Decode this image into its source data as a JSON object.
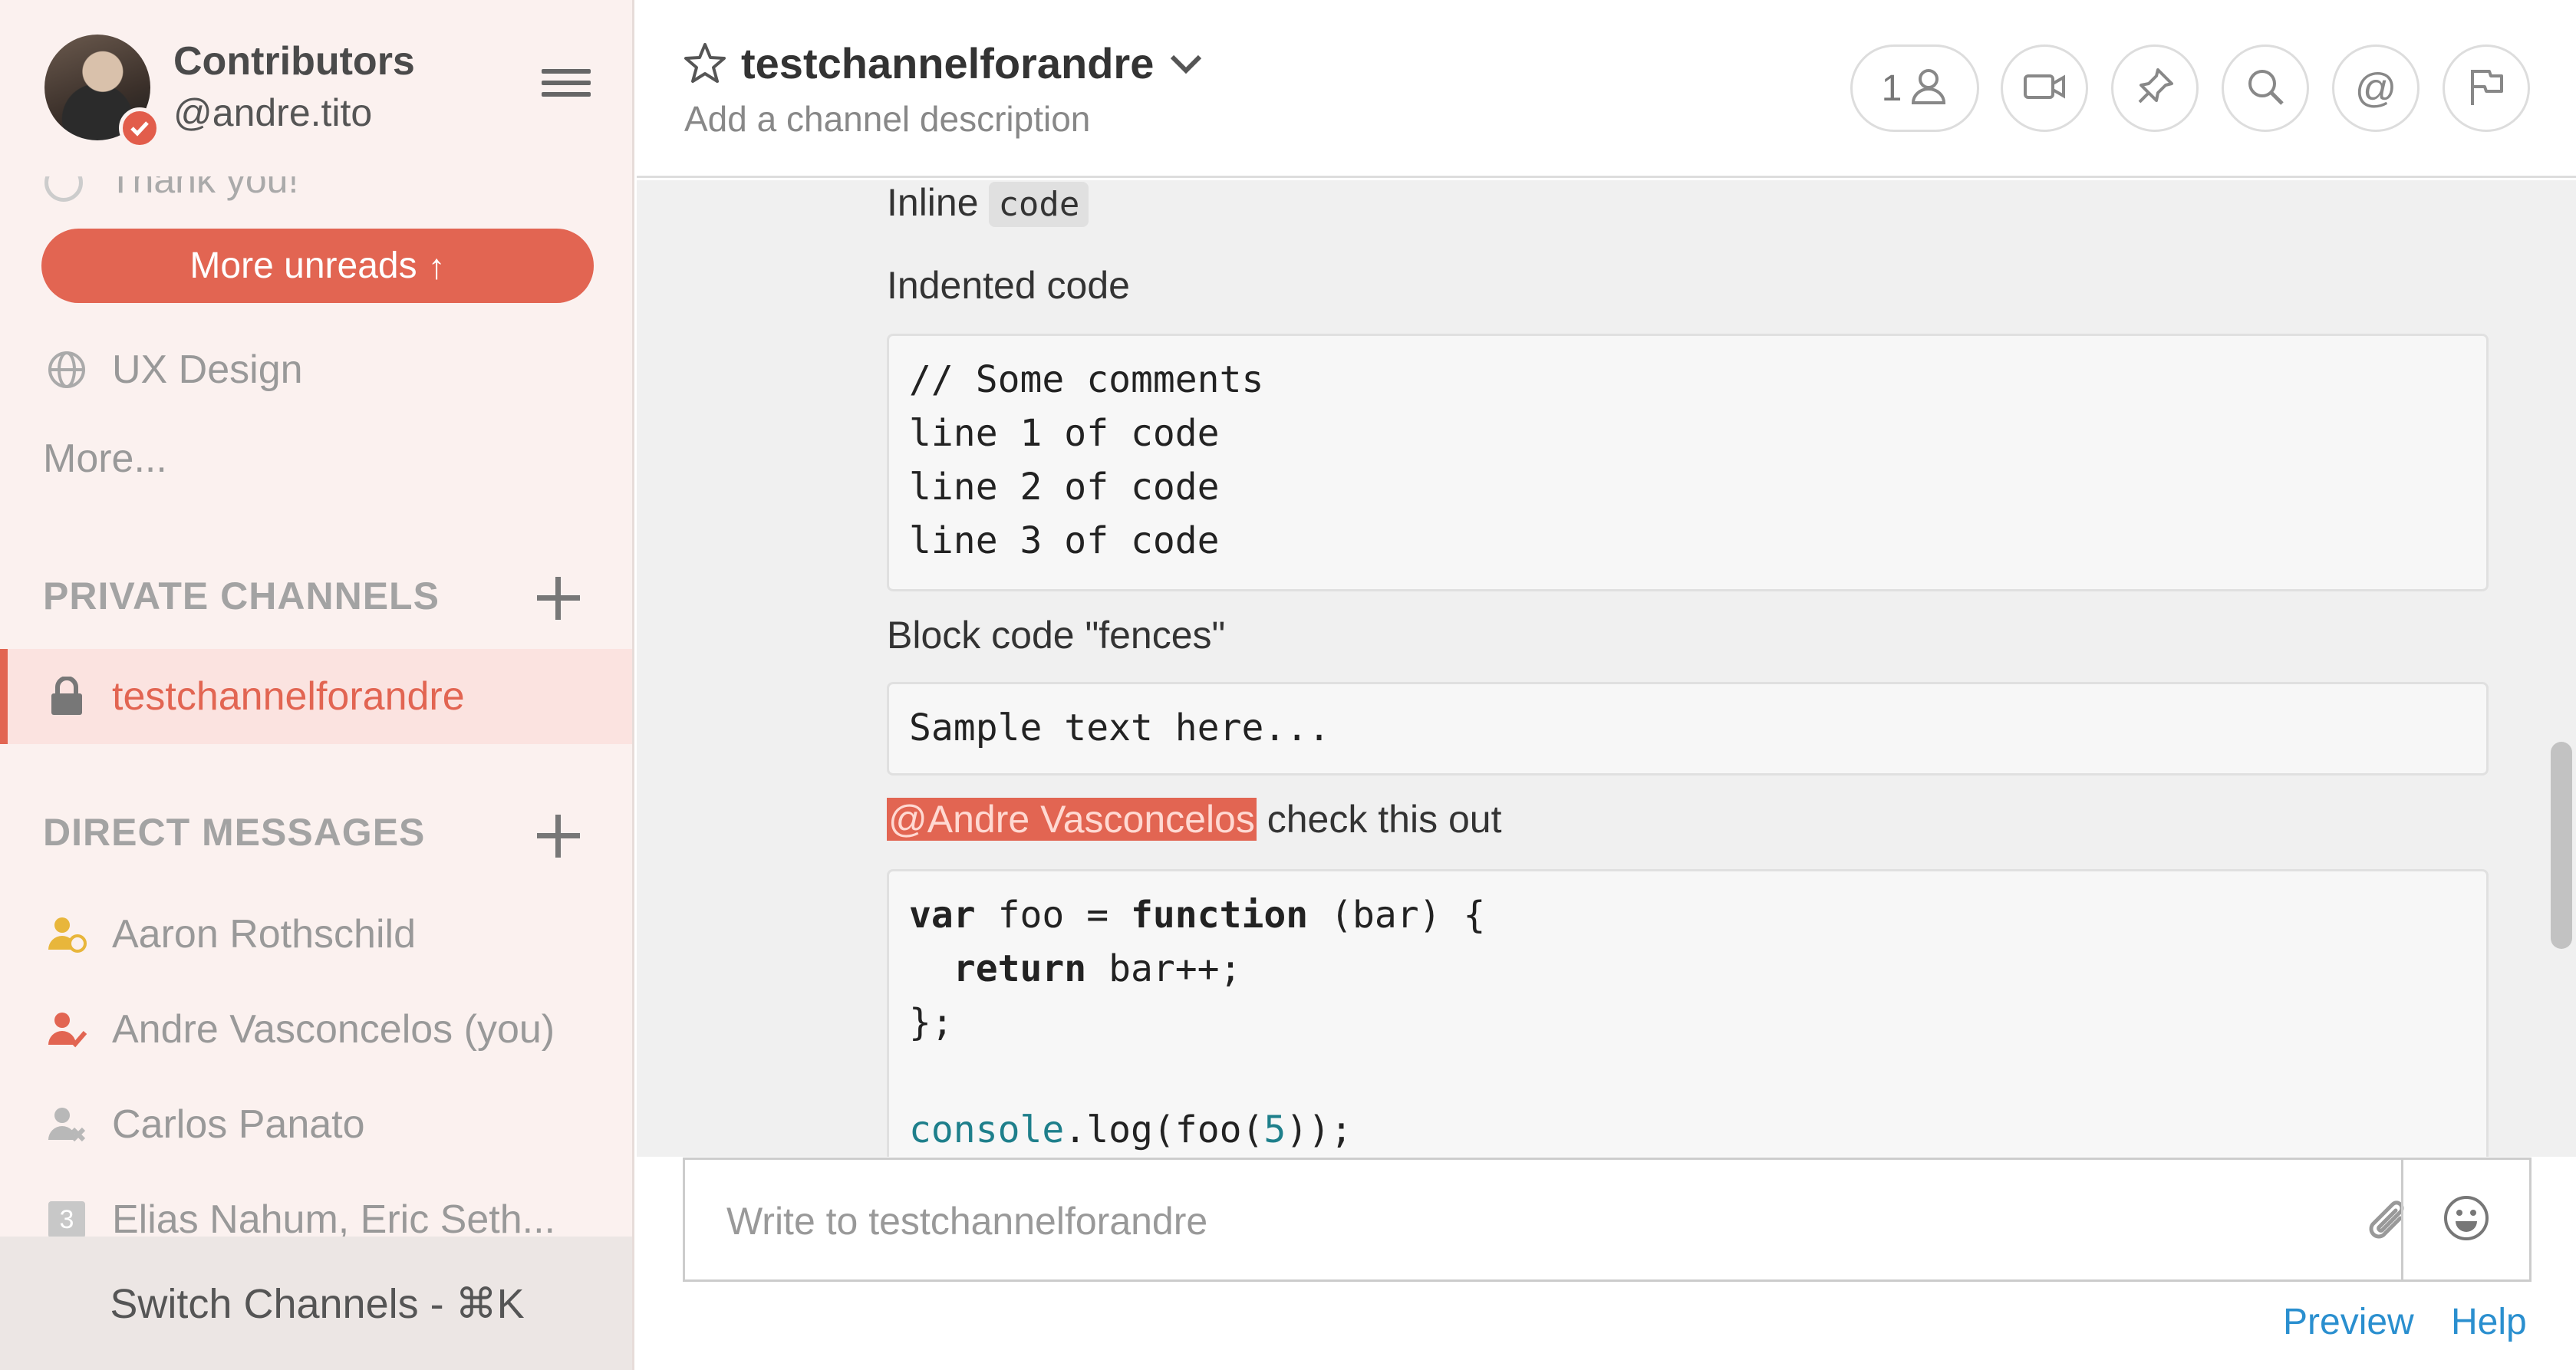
{
  "sidebar": {
    "team_name": "Contributors",
    "username": "@andre.tito",
    "partial_item": "Thank you!",
    "more_unreads": "More unreads",
    "public_items": [
      {
        "label": "UX Design",
        "icon": "globe-icon"
      }
    ],
    "more_link": "More...",
    "private_section_title": "PRIVATE CHANNELS",
    "private_items": [
      {
        "label": "testchannelforandre",
        "icon": "lock-icon",
        "active": true
      }
    ],
    "dm_section_title": "DIRECT MESSAGES",
    "dm_items": [
      {
        "label": "Aaron Rothschild",
        "status": "away"
      },
      {
        "label": "Andre Vasconcelos (you)",
        "status": "online"
      },
      {
        "label": "Carlos Panato",
        "status": "offline"
      },
      {
        "label": "Elias Nahum, Eric Seth...",
        "group_count": "3"
      }
    ],
    "switch_channels": "Switch Channels - ⌘K"
  },
  "header": {
    "channel_name": "testchannelforandre",
    "channel_description": "Add a channel description",
    "member_count": "1"
  },
  "messages": {
    "inline_label": "Inline",
    "inline_code": "code",
    "indented_label": "Indented code",
    "indented_code": "// Some comments\nline 1 of code\nline 2 of code\nline 3 of code",
    "fences_label": "Block code \"fences\"",
    "fences_code": "Sample text here...",
    "mention": "@Andre Vasconcelos",
    "mention_suffix": " check this out",
    "js_code": {
      "line1_kw": "var",
      "line1_mid": " foo = ",
      "line1_kw2": "function",
      "line1_end": " (bar) {",
      "line2_kw": "return",
      "line2_end": " bar++;",
      "line3": "};",
      "line5_fn": "console",
      "line5_mid": ".log(foo(",
      "line5_num": "5",
      "line5_end": "));"
    }
  },
  "composer": {
    "placeholder": "Write to testchannelforandre",
    "preview": "Preview",
    "help": "Help"
  },
  "colors": {
    "accent": "#e26552",
    "sidebar_bg": "#fbf1ef",
    "link": "#2a8fcf"
  }
}
